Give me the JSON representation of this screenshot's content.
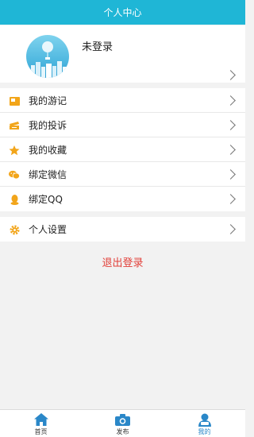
{
  "header": {
    "title": "个人中心"
  },
  "profile": {
    "status": "未登录"
  },
  "menu_group_1": [
    {
      "label": "我的游记",
      "icon": "notebook-icon"
    },
    {
      "label": "我的投诉",
      "icon": "ticket-icon"
    },
    {
      "label": "我的收藏",
      "icon": "star-icon"
    },
    {
      "label": "绑定微信",
      "icon": "wechat-icon"
    },
    {
      "label": "绑定QQ",
      "icon": "qq-icon"
    }
  ],
  "menu_group_2": [
    {
      "label": "个人设置",
      "icon": "gear-icon"
    }
  ],
  "logout": {
    "label": "退出登录"
  },
  "tabbar": [
    {
      "label": "首页",
      "icon": "home-icon"
    },
    {
      "label": "发布",
      "icon": "camera-icon"
    },
    {
      "label": "我的",
      "icon": "user-icon",
      "active": true
    }
  ],
  "colors": {
    "header": "#1fb6d6",
    "logout": "#e2403a",
    "icon_orange": "#f2a51a",
    "tab_icon": "#2a87c8"
  }
}
